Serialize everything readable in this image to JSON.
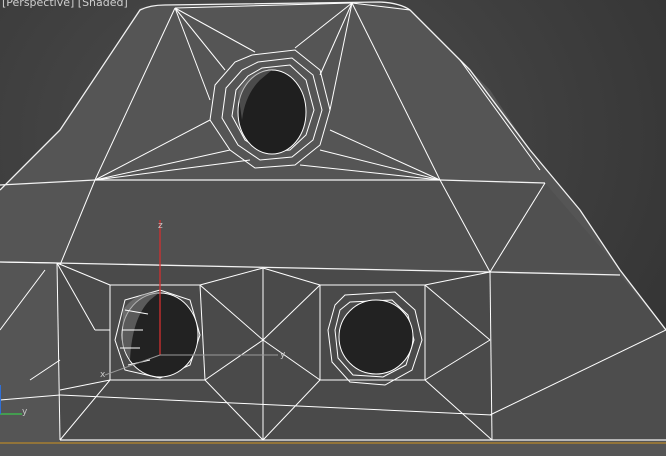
{
  "viewport": {
    "label": "[Perspective] [Shaded]",
    "background": "#3d3d3d",
    "wire_color": "#ffffff",
    "ground_line_color": "#b8862b"
  },
  "gizmo": {
    "z_axis_color": "#d23030",
    "x_label": "x",
    "y_label": "y",
    "z_label": "z"
  },
  "world_axes": {
    "x_color": "#2f6fd6",
    "y_color": "#3fb34f",
    "y_label": "y"
  },
  "icons": [
    "move-gizmo-icon",
    "world-axis-tripod-icon"
  ]
}
